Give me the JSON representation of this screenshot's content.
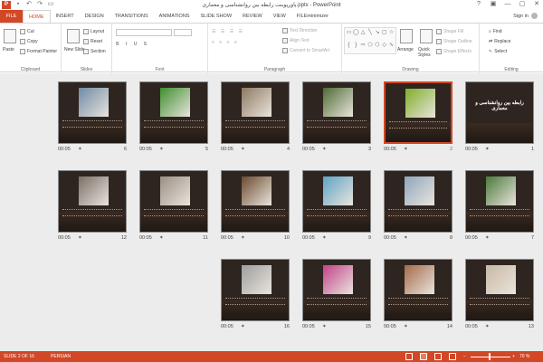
{
  "titlebar": {
    "app_icon": "P",
    "title": "پاورپوینت رابطه بین روانشناسی و معماری.pptx - PowerPoint",
    "quick_access": [
      "save-icon",
      "undo-icon",
      "redo-icon",
      "start-from-beginning-icon"
    ],
    "controls": [
      "?",
      "▣",
      "—",
      "▢",
      "✕"
    ]
  },
  "tabs": {
    "items": [
      "FILE",
      "HOME",
      "INSERT",
      "DESIGN",
      "TRANSITIONS",
      "ANIMATIONS",
      "SLIDE SHOW",
      "REVIEW",
      "VIEW",
      "FILEminimizer"
    ],
    "active": "HOME",
    "signin": "Sign in"
  },
  "ribbon": {
    "clipboard": {
      "label": "Clipboard",
      "paste": "Paste",
      "cut": "Cut",
      "copy": "Copy",
      "format_painter": "Format Painter"
    },
    "slides": {
      "label": "Slides",
      "new_slide": "New Slide",
      "layout": "Layout",
      "reset": "Reset",
      "section": "Section"
    },
    "font": {
      "label": "Font"
    },
    "paragraph": {
      "label": "Paragraph",
      "text_direction": "Text Direction",
      "align_text": "Align Text",
      "convert_smartart": "Convert to SmartArt"
    },
    "drawing": {
      "label": "Drawing",
      "arrange": "Arrange",
      "quick_styles": "Quick Styles",
      "shape_fill": "Shape Fill",
      "shape_outline": "Shape Outline",
      "shape_effects": "Shape Effects"
    },
    "editing": {
      "label": "Editing",
      "find": "Find",
      "replace": "Replace",
      "select": "Select"
    }
  },
  "slides": [
    {
      "number": "1",
      "time": "00:05",
      "title": "رابطه بین روانشناسی و معماری",
      "accent": "#2f2520"
    },
    {
      "number": "2",
      "time": "00:05",
      "accent": "#7fae2a"
    },
    {
      "number": "3",
      "time": "00:05",
      "accent": "#4e6b33"
    },
    {
      "number": "4",
      "time": "00:05",
      "accent": "#8d7a62"
    },
    {
      "number": "5",
      "time": "00:05",
      "accent": "#3f8f2f"
    },
    {
      "number": "6",
      "time": "00:05",
      "accent": "#6f8aa6"
    },
    {
      "number": "7",
      "time": "00:05",
      "accent": "#4a7a3a"
    },
    {
      "number": "8",
      "time": "00:05",
      "accent": "#8fa6bd"
    },
    {
      "number": "9",
      "time": "00:05",
      "accent": "#5fa3c6"
    },
    {
      "number": "10",
      "time": "00:05",
      "accent": "#6b4a2e"
    },
    {
      "number": "11",
      "time": "00:05",
      "accent": "#9a8f85"
    },
    {
      "number": "12",
      "time": "00:05",
      "accent": "#7a7068"
    },
    {
      "number": "13",
      "time": "00:05",
      "accent": "#c9b8a4"
    },
    {
      "number": "14",
      "time": "00:05",
      "accent": "#a56a4a"
    },
    {
      "number": "15",
      "time": "00:05",
      "accent": "#c2428a"
    },
    {
      "number": "16",
      "time": "00:05",
      "accent": "#9e9e9e"
    }
  ],
  "selected_slide": "2",
  "status": {
    "slide_info": "SLIDE 2 OF 16",
    "language": "PERSIAN",
    "zoom": "70 %"
  },
  "colors": {
    "accent": "#d24726",
    "sorter_bg": "#ececec"
  }
}
